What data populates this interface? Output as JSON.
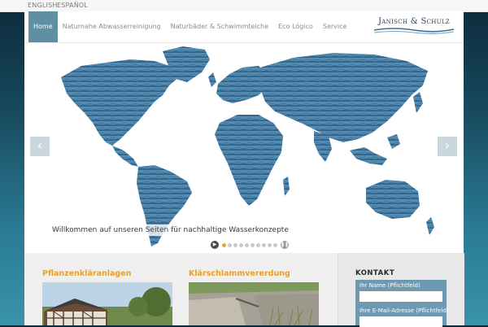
{
  "languages": [
    "ENGLISH",
    "ESPAÑOL"
  ],
  "nav": {
    "items": [
      {
        "label": "Home",
        "active": true
      },
      {
        "label": "Naturnahe Abwasserreinigung",
        "active": false
      },
      {
        "label": "Naturbäder & Schwimmteiche",
        "active": false
      },
      {
        "label": "Eco Lógico",
        "active": false
      },
      {
        "label": "Service",
        "active": false
      }
    ]
  },
  "logo": {
    "text": "Janisch & Schulz"
  },
  "slider": {
    "caption": "Willkommen auf unseren Seiten für nachhaltige Wasserkonzepte",
    "prev_icon": "chevron-left-icon",
    "next_icon": "chevron-right-icon",
    "slide_count": 10,
    "active_slide": 1
  },
  "columns": [
    {
      "title": "Pflanzenkläranlagen"
    },
    {
      "title": "Klärschlammvererdung"
    }
  ],
  "contact": {
    "title": "KONTAKT",
    "fields": [
      {
        "label": "Ihr Name (Pflichtfeld)",
        "value": ""
      },
      {
        "label": "Ihre E-Mail-Adresse (Pflichtfeld)",
        "value": ""
      }
    ]
  },
  "colors": {
    "accent": "#e7a12d",
    "nav_active": "#5e8fa3",
    "form_bg": "#6d9ab0",
    "water": "#3f78a1"
  }
}
